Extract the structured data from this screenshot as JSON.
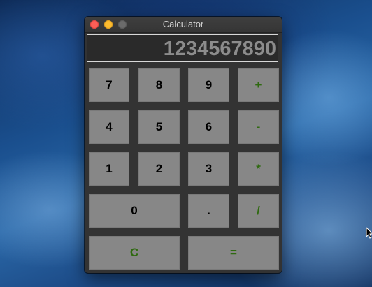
{
  "window": {
    "title": "Calculator"
  },
  "display": {
    "value": "1234567890"
  },
  "keys": {
    "seven": "7",
    "eight": "8",
    "nine": "9",
    "plus": "+",
    "four": "4",
    "five": "5",
    "six": "6",
    "minus": "-",
    "one": "1",
    "two": "2",
    "three": "3",
    "multiply": "*",
    "zero": "0",
    "decimal": ".",
    "divide": "/",
    "clear": "C",
    "equals": "="
  },
  "colors": {
    "operator_text": "#2f6a10",
    "digit_text": "#000000",
    "key_background": "#878787",
    "window_background": "#333333",
    "display_text": "#8c8c8c"
  },
  "icons": {
    "close": "close-icon",
    "minimize": "minimize-icon",
    "zoom": "zoom-icon",
    "cursor": "mouse-pointer-icon"
  }
}
